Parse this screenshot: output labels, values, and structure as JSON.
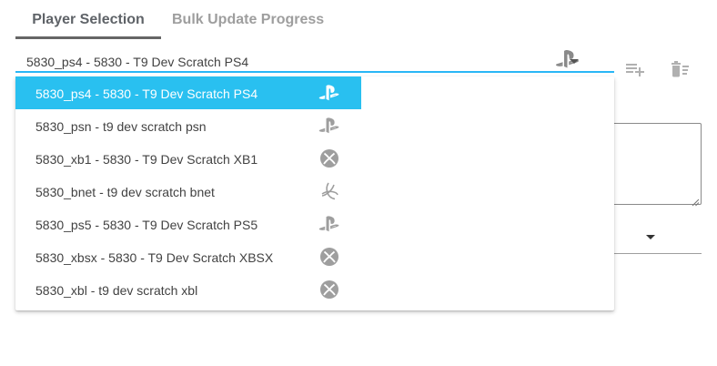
{
  "tabs": [
    {
      "label": "Player Selection",
      "active": true
    },
    {
      "label": "Bulk Update Progress",
      "active": false
    }
  ],
  "selector": {
    "value": "5830_ps4 - 5830 - T9 Dev Scratch PS4",
    "platform_icon": "playstation-icon"
  },
  "actions": {
    "add_icon": "playlist-add-icon",
    "delete_icon": "delete-sweep-icon"
  },
  "dropdown": {
    "options": [
      {
        "label": "5830_ps4 - 5830 - T9 Dev Scratch PS4",
        "icon": "playstation-icon",
        "selected": true
      },
      {
        "label": "5830_psn - t9 dev scratch psn",
        "icon": "playstation-icon",
        "selected": false
      },
      {
        "label": "5830_xb1 - 5830 - T9 Dev Scratch XB1",
        "icon": "xbox-icon",
        "selected": false
      },
      {
        "label": "5830_bnet - t9 dev scratch bnet",
        "icon": "battlenet-icon",
        "selected": false
      },
      {
        "label": "5830_ps5 - 5830 - T9 Dev Scratch PS5",
        "icon": "playstation-icon",
        "selected": false
      },
      {
        "label": "5830_xbsx - 5830 - T9 Dev Scratch XBSX",
        "icon": "xbox-icon",
        "selected": false
      },
      {
        "label": "5830_xbl - t9 dev scratch xbl",
        "icon": "xbox-icon",
        "selected": false
      }
    ]
  },
  "colors": {
    "accent": "#29c0f0",
    "underline_active": "#29b6f6",
    "icon_gray": "#9e9e9e"
  }
}
